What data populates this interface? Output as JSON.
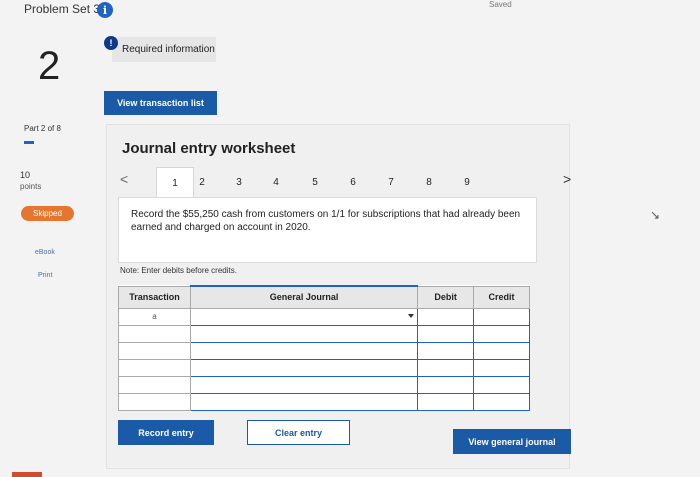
{
  "header": {
    "title": "Problem Set 3",
    "info_icon": "i",
    "saved_label": "Saved"
  },
  "sidebar": {
    "question_number": "2",
    "part_label": "Part 2 of 8",
    "points_value": "10",
    "points_label": "points",
    "skipped_label": "Skipped",
    "ebook_label": "eBook",
    "print_label": "Print"
  },
  "required_info": {
    "icon": "!",
    "label": "Required information"
  },
  "view_transaction_list_label": "View transaction list",
  "worksheet": {
    "title": "Journal entry worksheet",
    "prev_arrow": "<",
    "next_arrow": ">",
    "tabs": [
      "1",
      "2",
      "3",
      "4",
      "5",
      "6",
      "7",
      "8",
      "9"
    ],
    "active_tab": "1",
    "instruction": "Record the $55,250 cash from customers on 1/1 for subscriptions that had already been earned and charged on account in 2020.",
    "note": "Note: Enter debits before credits."
  },
  "table": {
    "headers": {
      "transaction": "Transaction",
      "general_journal": "General Journal",
      "debit": "Debit",
      "credit": "Credit"
    },
    "rows": [
      {
        "transaction": "a"
      },
      {
        "transaction": ""
      },
      {
        "transaction": ""
      },
      {
        "transaction": ""
      },
      {
        "transaction": ""
      },
      {
        "transaction": ""
      }
    ]
  },
  "buttons": {
    "record_entry": "Record entry",
    "clear_entry": "Clear entry",
    "view_general_journal": "View general journal"
  },
  "colors": {
    "primary": "#1b5aa6",
    "skipped": "#e6762e",
    "accent_blue": "#1f63c4"
  }
}
